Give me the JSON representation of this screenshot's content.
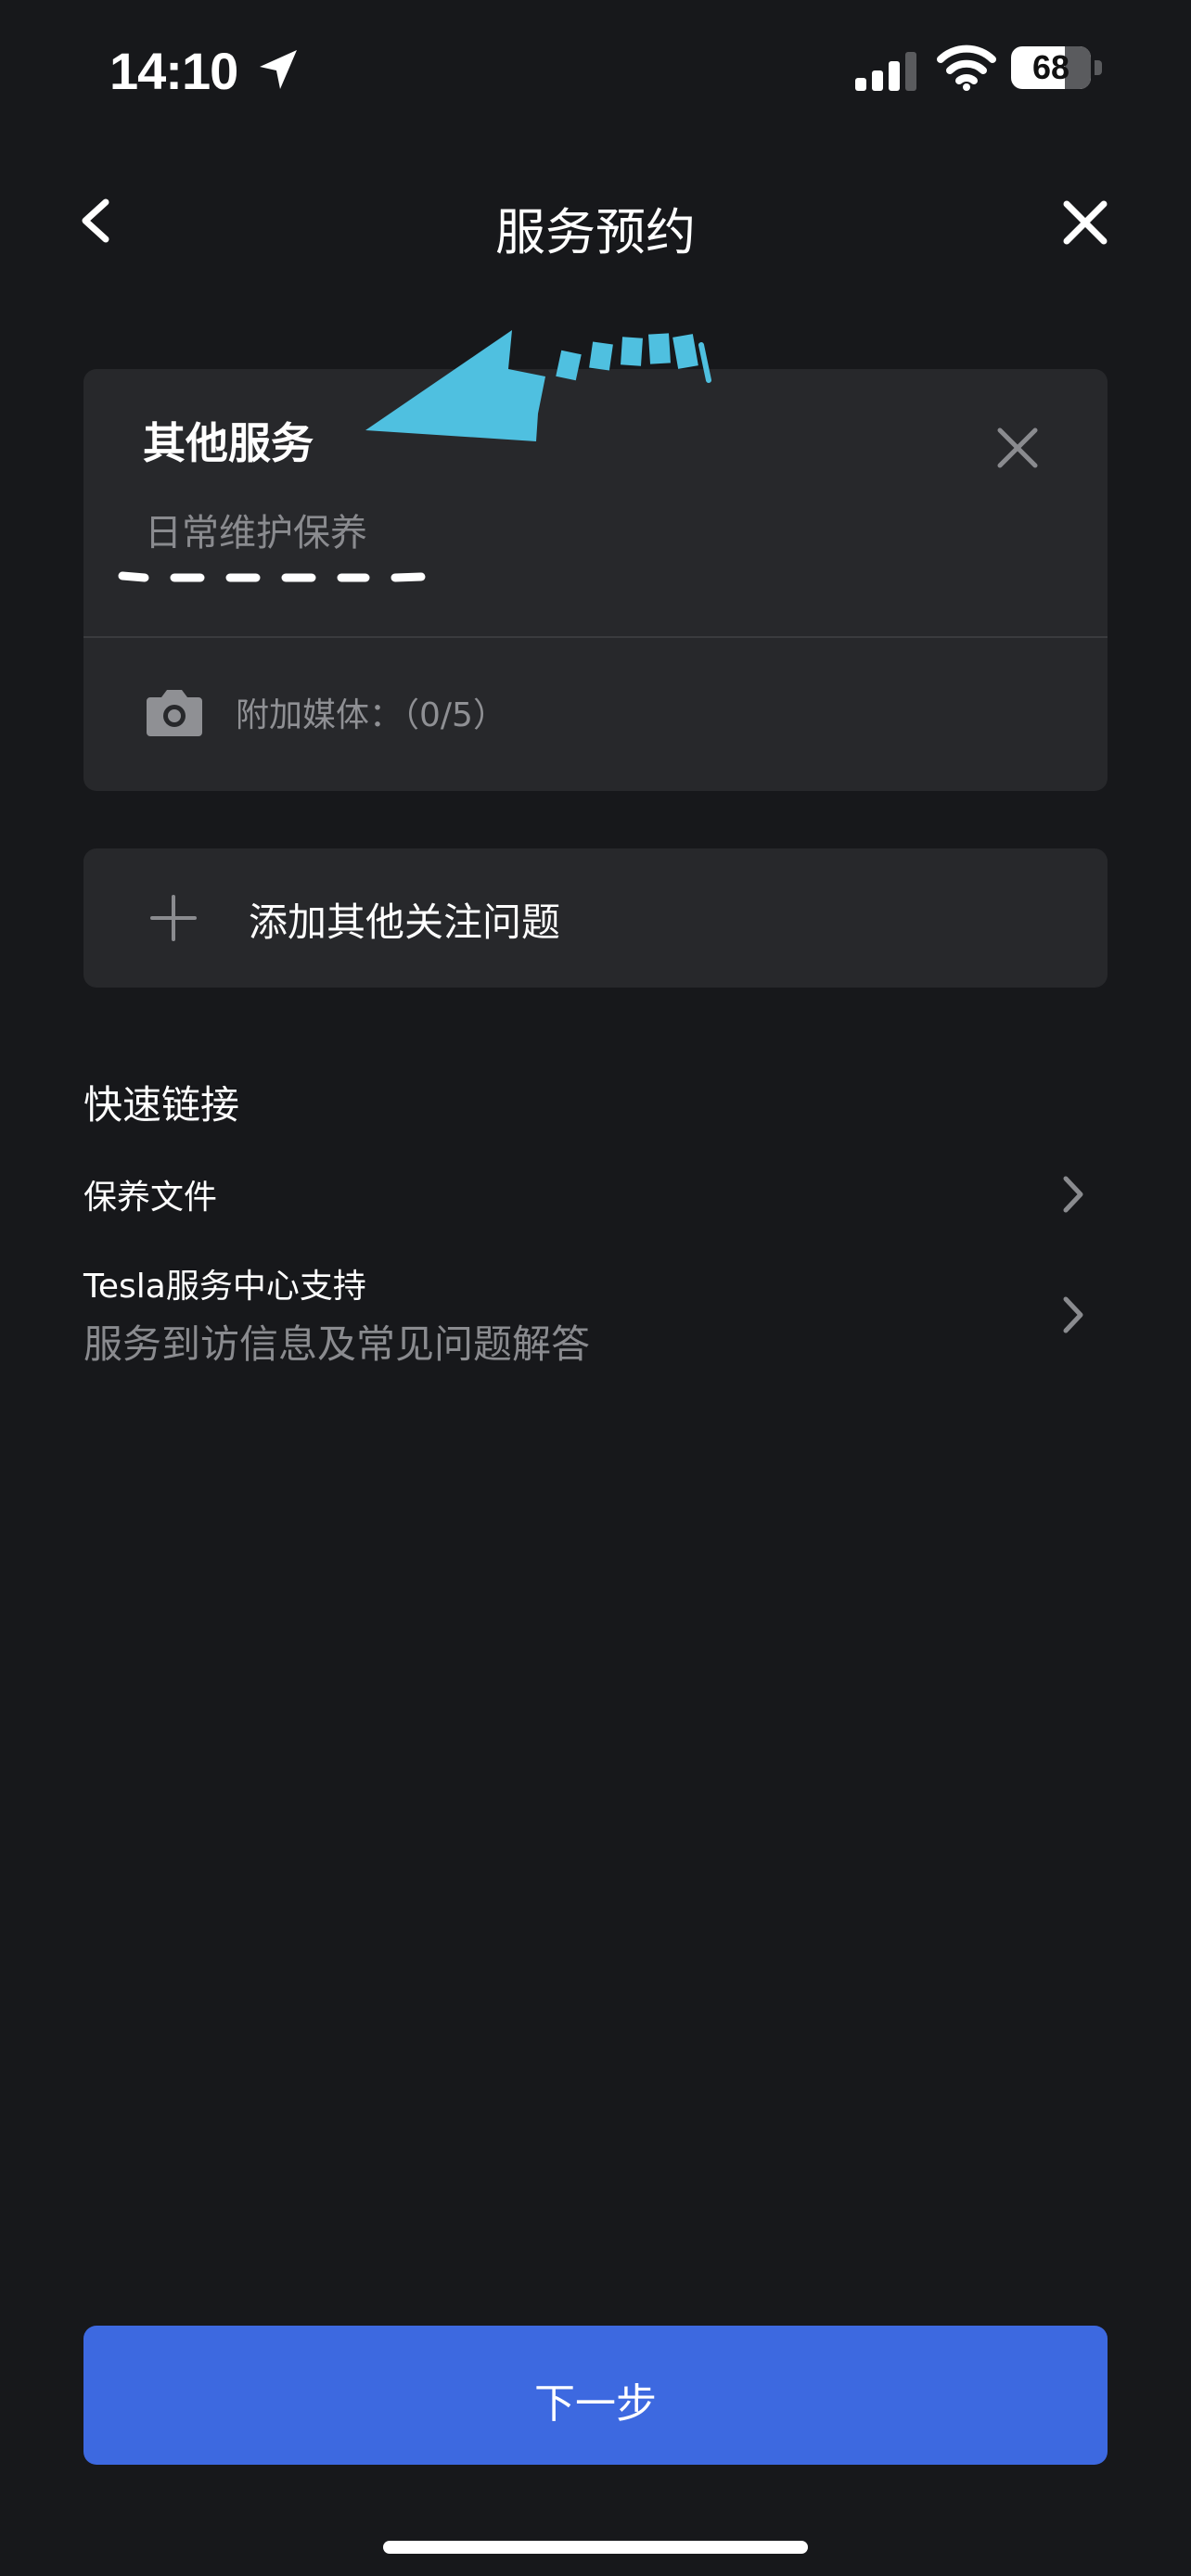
{
  "status_bar": {
    "time": "14:10",
    "battery": "68"
  },
  "header": {
    "title": "服务预约"
  },
  "service_card": {
    "title": "其他服务",
    "subtitle": "日常维护保养",
    "media_label": "附加媒体：（0/5）"
  },
  "add_issue": {
    "label": "添加其他关注问题"
  },
  "quick_links": {
    "title": "快速链接",
    "items": [
      {
        "label": "保养文件"
      },
      {
        "label": "Tesla服务中心支持",
        "sub": "服务到访信息及常见问题解答"
      }
    ]
  },
  "footer": {
    "next_label": "下一步"
  },
  "colors": {
    "background": "#17181b",
    "card": "#27282b",
    "primary_button": "#3d69e0",
    "annotation_arrow": "#4fc0e0",
    "annotation_dash": "#ffffff"
  }
}
